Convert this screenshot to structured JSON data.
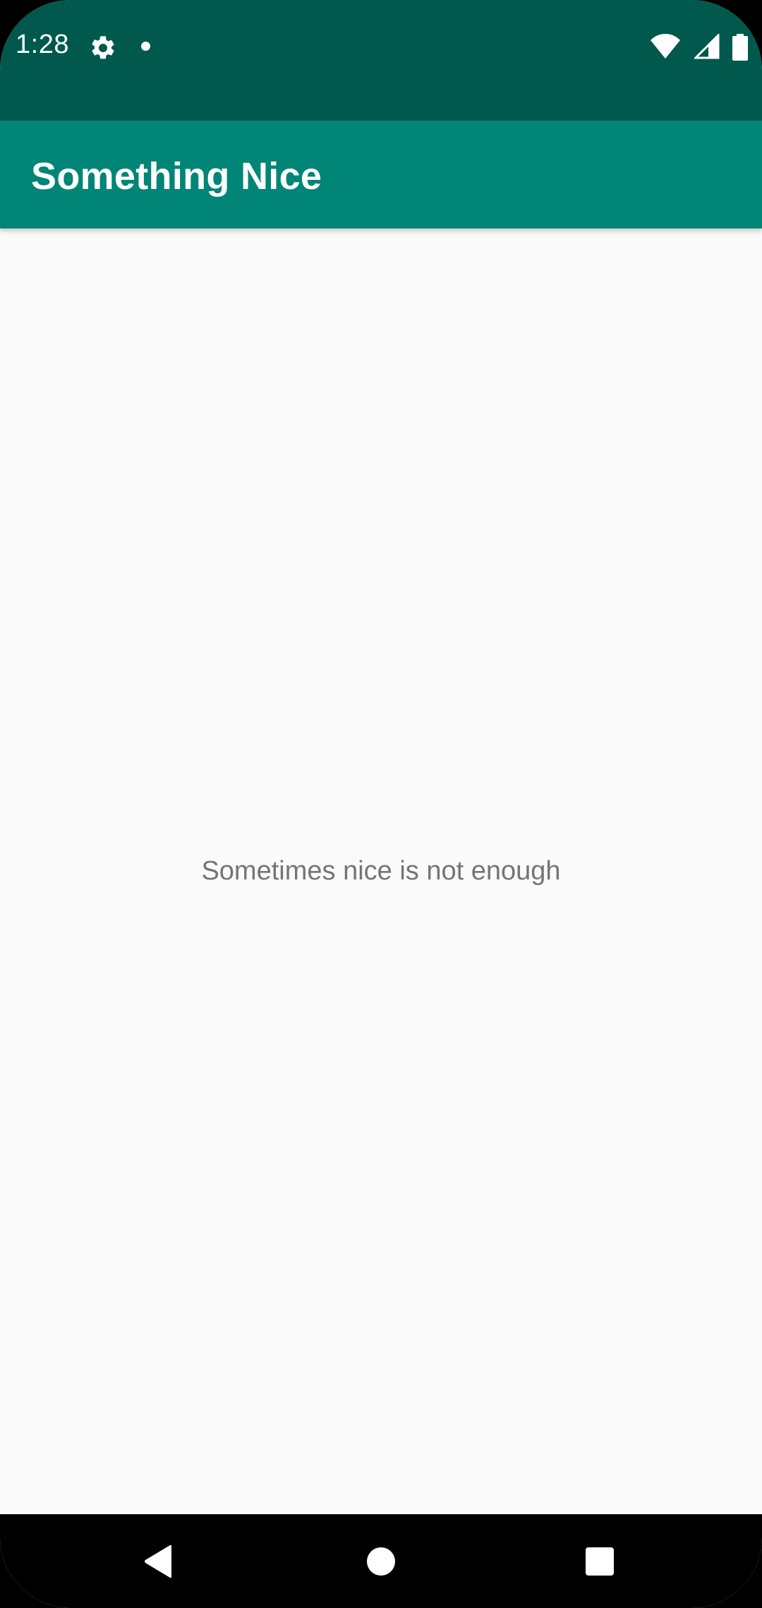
{
  "status_bar": {
    "time": "1:28",
    "left_icons": [
      "gear-icon",
      "notification-dot-icon"
    ],
    "right_icons": [
      "wifi-icon",
      "cell-signal-icon",
      "battery-icon"
    ],
    "color": "#00594c"
  },
  "app_bar": {
    "title": "Something Nice",
    "color": "#008577"
  },
  "main": {
    "message": "Sometimes nice is not enough"
  },
  "nav_bar": {
    "buttons": [
      "back-icon",
      "home-icon",
      "recents-icon"
    ]
  }
}
